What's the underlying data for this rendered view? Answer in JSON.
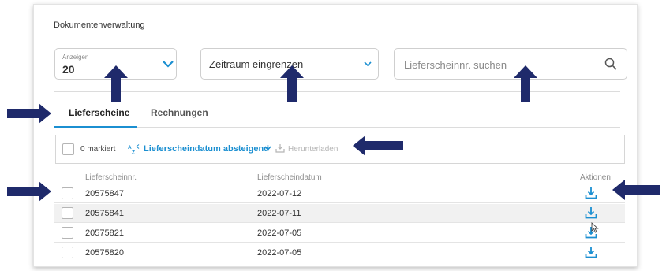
{
  "page": {
    "title": "Dokumentenverwaltung"
  },
  "filters": {
    "show": {
      "label": "Anzeigen",
      "value": "20"
    },
    "period": {
      "label": "Zeitraum eingrenzen"
    },
    "search": {
      "placeholder": "Lieferscheinnr. suchen"
    }
  },
  "tabs": [
    {
      "label": "Lieferscheine",
      "active": true
    },
    {
      "label": "Rechnungen",
      "active": false
    }
  ],
  "toolbar": {
    "marked_label": "0 markiert",
    "sort_label": "Lieferscheindatum absteigend",
    "download_label": "Herunterladen"
  },
  "table": {
    "columns": [
      "Lieferscheinnr.",
      "Lieferscheindatum",
      "Aktionen"
    ],
    "rows": [
      {
        "id": "20575847",
        "date": "2022-07-12"
      },
      {
        "id": "20575841",
        "date": "2022-07-11"
      },
      {
        "id": "20575821",
        "date": "2022-07-05"
      },
      {
        "id": "20575820",
        "date": "2022-07-05"
      }
    ]
  },
  "colors": {
    "accent": "#1b8fd1",
    "annotation_arrow": "#1f2a6b"
  }
}
